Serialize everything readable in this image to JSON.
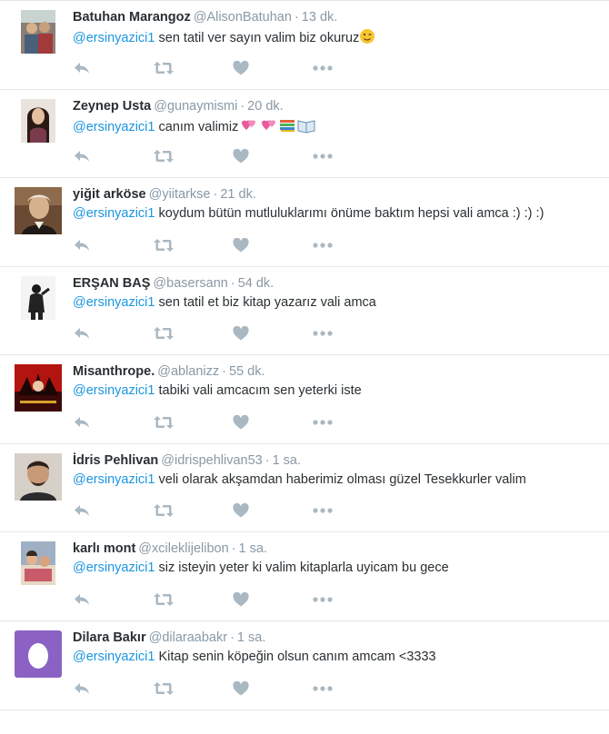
{
  "colors": {
    "mention": "#1b95e0",
    "meta": "#8899a6",
    "icon": "#aab8c2",
    "divider": "#e1e8ed"
  },
  "tweets": [
    {
      "fullname": "Batuhan Marangoz",
      "username": "@AlisonBatuhan",
      "sep": "·",
      "time": "13 dk.",
      "mention": "@ersinyazici1",
      "text": " sen tatil ver sayın valim biz okuruz",
      "emoji": "wink-emoji",
      "avatar": "photo-avatar"
    },
    {
      "fullname": "Zeynep Usta",
      "username": "@gunaymismi",
      "sep": "·",
      "time": "20 dk.",
      "mention": "@ersinyazici1",
      "text": " canım valimiz ",
      "emoji": "hearts-books-emoji",
      "avatar": "photo-avatar"
    },
    {
      "fullname": "yiğit arköse",
      "username": "@yiitarkse",
      "sep": "·",
      "time": "21 dk.",
      "mention": "@ersinyazici1",
      "text": " koydum bütün mutluluklarımı önüme baktım hepsi vali amca :) :) :)",
      "avatar": "photo-avatar"
    },
    {
      "fullname": "ERŞAN BAŞ",
      "username": "@basersann",
      "sep": "·",
      "time": "54 dk.",
      "mention": "@ersinyazici1",
      "text": " sen tatil et biz kitap yazarız vali amca",
      "avatar": "photo-avatar"
    },
    {
      "fullname": "Misanthrope.",
      "username": "@ablanizz",
      "sep": "·",
      "time": "55 dk.",
      "mention": "@ersinyazici1",
      "text": " tabiki vali amcacım sen yeterki iste",
      "avatar": "photo-avatar"
    },
    {
      "fullname": "İdris Pehlivan",
      "username": "@idrispehlivan53",
      "sep": "·",
      "time": "1 sa.",
      "mention": "@ersinyazici1",
      "text": " veli olarak akşamdan haberimiz olması güzel  Tesekkurler valim",
      "avatar": "photo-avatar"
    },
    {
      "fullname": "karlı mont",
      "username": "@xcileklijelibon",
      "sep": "·",
      "time": "1 sa.",
      "mention": "@ersinyazici1",
      "text": " siz isteyin yeter ki valim kitaplarla uyicam bu gece",
      "avatar": "photo-avatar"
    },
    {
      "fullname": "Dilara Bakır",
      "username": "@dilaraabakr",
      "sep": "·",
      "time": "1 sa.",
      "mention": "@ersinyazici1",
      "text": " Kitap senin köpeğin olsun canım amcam <3333",
      "avatar": "egg-avatar"
    }
  ],
  "action_icons": [
    "reply-icon",
    "retweet-icon",
    "like-icon",
    "more-icon"
  ]
}
